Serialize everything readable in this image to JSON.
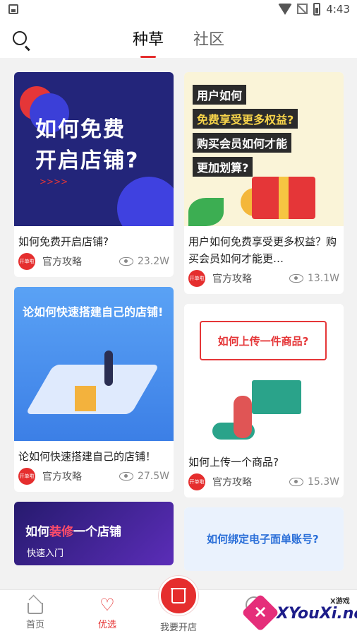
{
  "status_bar": {
    "time": "4:43"
  },
  "header": {
    "tabs": [
      {
        "label": "种草",
        "active": true
      },
      {
        "label": "社区",
        "active": false
      }
    ]
  },
  "feed": {
    "cards": [
      {
        "thumb_lines": [
          "如何免费",
          "开启店铺?"
        ],
        "title": "如何免费开启店铺?",
        "author": "官方攻略",
        "avatar_text": "开单啦",
        "views": "23.2W"
      },
      {
        "thumb_lines": [
          "用户如何",
          "免费享受更多权益?",
          "购买会员如何才能",
          "更加划算?"
        ],
        "title": "用户如何免费享受更多权益？购买会员如何才能更…",
        "author": "官方攻略",
        "avatar_text": "开单啦",
        "views": "13.1W"
      },
      {
        "thumb_lines": [
          "论如何快速搭建自己的店铺!"
        ],
        "title": "论如何快速搭建自己的店铺！",
        "author": "官方攻略",
        "avatar_text": "开单啦",
        "views": "27.5W"
      },
      {
        "thumb_lines": [
          "如何上传一件商品?"
        ],
        "title": "如何上传一个商品?",
        "author": "官方攻略",
        "avatar_text": "开单啦",
        "views": "15.3W"
      },
      {
        "thumb_lines": [
          "如何",
          "装修",
          "一个店铺",
          "快速入门"
        ],
        "title": "",
        "author": "",
        "avatar_text": "",
        "views": ""
      },
      {
        "thumb_lines": [
          "如何绑定电子面单账号?"
        ],
        "title": "",
        "author": "",
        "avatar_text": "",
        "views": ""
      }
    ]
  },
  "bottom_nav": {
    "items": [
      {
        "label": "首页",
        "icon": "home-icon"
      },
      {
        "label": "优选",
        "icon": "heart-icon",
        "active": true
      },
      {
        "label": "我要开店",
        "icon": "store-icon"
      },
      {
        "label": "",
        "icon": "user-icon"
      }
    ]
  },
  "watermark": {
    "top": "X游戏",
    "text": "XYouXi.net"
  },
  "colors": {
    "accent": "#e52e2e"
  }
}
